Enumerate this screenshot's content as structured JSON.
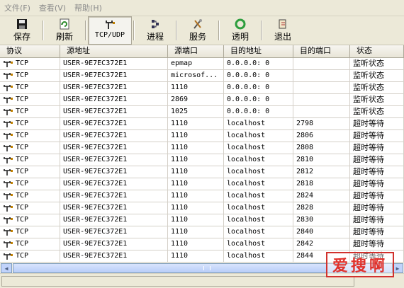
{
  "menu": [
    "文件(F)",
    "查看(V)",
    "帮助(H)"
  ],
  "toolbar": {
    "save": "保存",
    "refresh": "刷新",
    "tcpudp": "TCP/UDP",
    "process": "进程",
    "service": "服务",
    "transparent": "透明",
    "exit": "退出"
  },
  "columns": [
    "协议",
    "源地址",
    "源端口",
    "目的地址",
    "目的端口",
    "状态"
  ],
  "rows": [
    [
      "TCP",
      "USER-9E7EC372E1",
      "epmap",
      "0.0.0.0: 0",
      "",
      "监听状态"
    ],
    [
      "TCP",
      "USER-9E7EC372E1",
      "microsof...",
      "0.0.0.0: 0",
      "",
      "监听状态"
    ],
    [
      "TCP",
      "USER-9E7EC372E1",
      "1110",
      "0.0.0.0: 0",
      "",
      "监听状态"
    ],
    [
      "TCP",
      "USER-9E7EC372E1",
      "2869",
      "0.0.0.0: 0",
      "",
      "监听状态"
    ],
    [
      "TCP",
      "USER-9E7EC372E1",
      "1025",
      "0.0.0.0: 0",
      "",
      "监听状态"
    ],
    [
      "TCP",
      "USER-9E7EC372E1",
      "1110",
      "localhost",
      "2798",
      "超时等待"
    ],
    [
      "TCP",
      "USER-9E7EC372E1",
      "1110",
      "localhost",
      "2806",
      "超时等待"
    ],
    [
      "TCP",
      "USER-9E7EC372E1",
      "1110",
      "localhost",
      "2808",
      "超时等待"
    ],
    [
      "TCP",
      "USER-9E7EC372E1",
      "1110",
      "localhost",
      "2810",
      "超时等待"
    ],
    [
      "TCP",
      "USER-9E7EC372E1",
      "1110",
      "localhost",
      "2812",
      "超时等待"
    ],
    [
      "TCP",
      "USER-9E7EC372E1",
      "1110",
      "localhost",
      "2818",
      "超时等待"
    ],
    [
      "TCP",
      "USER-9E7EC372E1",
      "1110",
      "localhost",
      "2824",
      "超时等待"
    ],
    [
      "TCP",
      "USER-9E7EC372E1",
      "1110",
      "localhost",
      "2828",
      "超时等待"
    ],
    [
      "TCP",
      "USER-9E7EC372E1",
      "1110",
      "localhost",
      "2830",
      "超时等待"
    ],
    [
      "TCP",
      "USER-9E7EC372E1",
      "1110",
      "localhost",
      "2840",
      "超时等待"
    ],
    [
      "TCP",
      "USER-9E7EC372E1",
      "1110",
      "localhost",
      "2842",
      "超时等待"
    ],
    [
      "TCP",
      "USER-9E7EC372E1",
      "1110",
      "localhost",
      "2844",
      "超时等待"
    ]
  ],
  "watermark": "爱搜啊",
  "icons": {
    "save": "floppy-disk-icon",
    "refresh": "refresh-icon",
    "tcpudp": "network-plug-icon",
    "process": "process-icon",
    "service": "service-tools-icon",
    "transparent": "recycle-icon",
    "exit": "exit-door-icon",
    "protocol": "plug-icon"
  },
  "colors": {
    "watermark": "#e0312b",
    "refresh": "#2e8b2e"
  }
}
